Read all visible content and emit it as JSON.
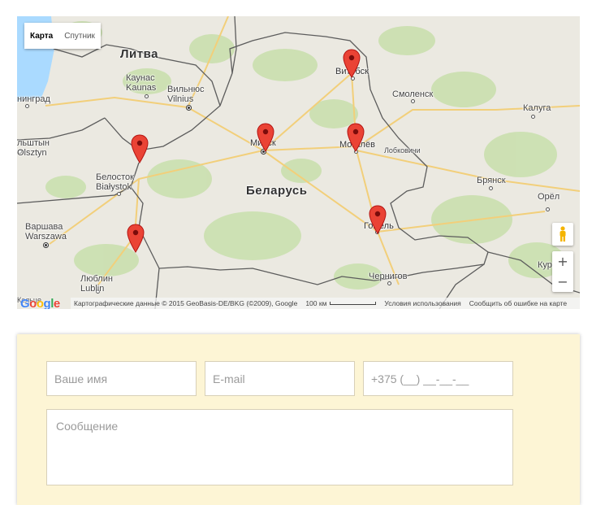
{
  "map": {
    "type_control": {
      "map_label": "Карта",
      "satellite_label": "Спутник",
      "active": "map"
    },
    "country_labels": {
      "lithuania": "Литва",
      "belarus": "Беларусь"
    },
    "cities": {
      "kaunas": [
        "Каунас",
        "Kaunas"
      ],
      "vilnius": [
        "Вильнюс",
        "Vilnius"
      ],
      "belostok": [
        "Белосток",
        "Białystok"
      ],
      "warsaw": [
        "Варшава",
        "Warszawa"
      ],
      "lublin": [
        "Люблин",
        "Lublin"
      ],
      "olsztyn": [
        "льштын",
        "Olsztyn"
      ],
      "minsk": "Минск",
      "vitebsk": "Витебск",
      "mogilev": "Могилёв",
      "gomel": "Гомель",
      "smolensk": "Смоленск",
      "kaluga": "Калуга",
      "bryansk": "Брянск",
      "orel": "Орёл",
      "chernigov": "Чернигов",
      "lobkovichi": "Лобковичи",
      "kursk": "Курс",
      "kaliningrad": "нинград",
      "kielce": "Кельце"
    },
    "markers": [
      "Минск",
      "Витебск",
      "Могилёв",
      "Гомель",
      "Гродно",
      "Брест"
    ],
    "zoom_in": "+",
    "zoom_out": "−",
    "google_logo": "Google",
    "attribution": {
      "data": "Картографические данные © 2015 GeoBasis-DE/BKG (©2009), Google",
      "scale": "100 км",
      "terms": "Условия использования",
      "report": "Сообщить об ошибке на карте"
    },
    "colors": {
      "land": "#ebe9e1",
      "green": "#c8dfac",
      "border": "#5c5c5c",
      "road": "#f2cf7a",
      "marker": "#ea4335",
      "water": "#aadaff"
    }
  },
  "form": {
    "name_placeholder": "Ваше имя",
    "email_placeholder": "E-mail",
    "phone_placeholder": "+375 (__) __-__-__",
    "message_placeholder": "Сообщение",
    "panel_color": "#fdf5d5"
  }
}
